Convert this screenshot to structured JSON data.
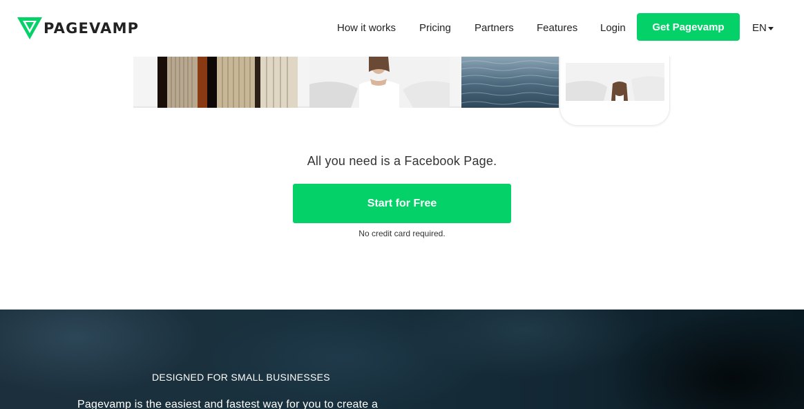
{
  "header": {
    "brand": "PAGEVAMP",
    "nav": [
      {
        "label": "How it works"
      },
      {
        "label": "Pricing"
      },
      {
        "label": "Partners"
      },
      {
        "label": "Features"
      },
      {
        "label": "Login"
      }
    ],
    "cta_label": "Get Pagevamp",
    "language": "EN",
    "accent_color": "#05d169"
  },
  "hero": {
    "tagline": "All you need is a Facebook Page.",
    "start_label": "Start for Free",
    "note": "No credit card required."
  },
  "dark_section": {
    "eyebrow": "DESIGNED FOR SMALL BUSINESSES",
    "body": "Pagevamp is the easiest and fastest way for you to create a"
  },
  "icons": [
    "pagevamp-logo-icon",
    "caret-down-icon"
  ]
}
